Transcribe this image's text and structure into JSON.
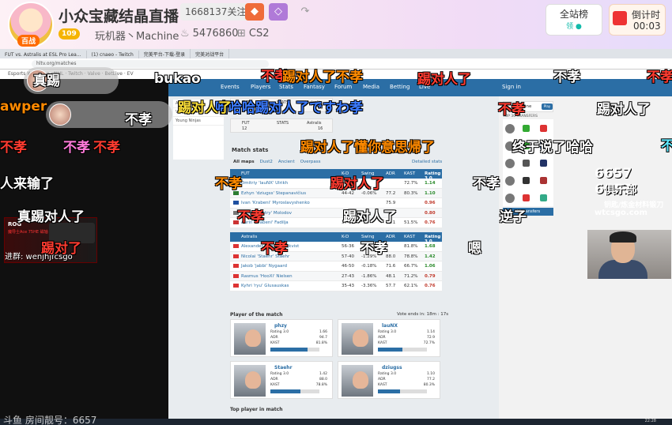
{
  "header": {
    "room_title": "小众宝藏结晶直播",
    "follow_count": "1668137关注",
    "level_badge": "109",
    "avatar_badge": "百战",
    "category": "玩机器丶Machine",
    "heat": "5476860",
    "game": "CS2",
    "rank_label": "全站榜",
    "rank_sub": "领 ●",
    "countdown_label": "倒计时",
    "countdown_time": "00:03"
  },
  "browser": {
    "tabs": [
      "FUT vs. Astralis at ESL Pro Lea...",
      "(1) cnaeo - Twitch",
      "完美平台-下载-登录",
      "完美对战平台"
    ],
    "address": "hltv.org/matches",
    "bookmarks": "Esports Wrestling · NHL · Twitch · Valve · BetLive · EV"
  },
  "site_nav": {
    "items": [
      "Events",
      "Players",
      "Stats",
      "Fantasy",
      "Forum",
      "Media",
      "Betting",
      "Live"
    ],
    "signin": "Sign in"
  },
  "page": {
    "left_col": [
      "Aurora",
      "Vitality",
      "Young Ninjas"
    ],
    "scores": [
      {
        "team_a": "FUT",
        "stat": "STATS",
        "team_b": "Astralis",
        "a": "12",
        "b": "16"
      },
      {
        "team_a": "FUT",
        "stat": "STATS",
        "team_b": "Astralis",
        "a": "12",
        "b": "16"
      }
    ],
    "match_stats_title": "Match stats",
    "filters": [
      "All maps",
      "Dust2",
      "Ancient",
      "Overpass"
    ],
    "detailed_stats": "Detailed stats",
    "fut_table": {
      "header": [
        "FUT",
        "K-D",
        "Swing",
        "ADR",
        "KAST",
        "Rating 3.0"
      ],
      "rows": [
        {
          "name": "Dmitriy 'lauNX' Ulrikh",
          "kd": "",
          "swing": "",
          "adr": "",
          "kast": "72.7%",
          "rating": "1.14"
        },
        {
          "name": "Ezhyn 'dziugss' Stepanavičius",
          "kd": "44-42",
          "swing": "-0.06%",
          "adr": "77.2",
          "kast": "80.3%",
          "rating": "1.10"
        },
        {
          "name": "Ivan 'Krabeni' Myroslavyshenko",
          "kd": "",
          "swing": "",
          "adr": "75.9",
          "kast": "",
          "rating": "0.96"
        },
        {
          "name": "Oleksii 'cmtry' Molodov",
          "kd": "",
          "swing": "",
          "adr": "",
          "kast": "",
          "rating": "0.80"
        },
        {
          "name": "Aurin 'Krabeni' Fadilja",
          "kd": "37-51",
          "swing": "",
          "adr": "62.1",
          "kast": "51.5%",
          "rating": "0.76"
        }
      ]
    },
    "ast_table": {
      "header": [
        "Astralis",
        "K-D",
        "Swing",
        "ADR",
        "KAST",
        "Rating 3.0"
      ],
      "rows": [
        {
          "name": "Alexander 'phzy' Bergkvist",
          "kd": "56-36",
          "swing": "",
          "adr": "",
          "kast": "81.8%",
          "rating": "1.68"
        },
        {
          "name": "Nicolai 'Staehr' Staehr",
          "kd": "57-40",
          "swing": "-1.29%",
          "adr": "88.0",
          "kast": "78.8%",
          "rating": "1.42"
        },
        {
          "name": "Jakob 'jabbi' Nygaard",
          "kd": "46-50",
          "swing": "-0.18%",
          "adr": "71.6",
          "kast": "66.7%",
          "rating": "1.06"
        },
        {
          "name": "Rasmus 'HooXi' Nielsen",
          "kd": "27-43",
          "swing": "-1.86%",
          "adr": "48.1",
          "kast": "71.2%",
          "rating": "0.79"
        },
        {
          "name": "Kyhri 'ryu' Glusauskas",
          "kd": "35-43",
          "swing": "-3.36%",
          "adr": "57.7",
          "kast": "62.1%",
          "rating": "0.76"
        }
      ]
    },
    "potm_title": "Player of the match",
    "vote_text": "Vote ends in: 18m : 17s",
    "potm": [
      {
        "name": "phzy",
        "rating": "1.66",
        "adr": "94.7",
        "kast": "81.8%",
        "bar": 0.75
      },
      {
        "name": "lauNX",
        "rating": "1.14",
        "adr": "72.9",
        "kast": "72.7%",
        "bar": 0.5
      },
      {
        "name": "Staehr",
        "rating": "1.42",
        "adr": "88.0",
        "kast": "78.8%",
        "bar": 0.62
      },
      {
        "name": "dziugss",
        "rating": "1.10",
        "adr": "77.2",
        "kast": "80.3%",
        "bar": 0.45
      }
    ],
    "potm_labels": {
      "rating": "Rating 3.0",
      "adr": "ADR",
      "kast": "KAST"
    },
    "top_player": "Top player in match"
  },
  "sidebar_right": {
    "timeline": "Timeline",
    "play": "Play",
    "transfers_title": "TOP 30 TRANSFERS",
    "all_transfers": "All transfers"
  },
  "ads": {
    "big": "6657 6657",
    "sub": "俱乐部",
    "line": "钥匙/炼金材料锻刀",
    "url": "wtcsgo.com",
    "rog_title": "ROG",
    "rog_sub": "魔导士Ace 75HE 磁轴",
    "rog_user": "进群: wenjhjfcsgo"
  },
  "danmaku": [
    {
      "text": "真踢",
      "cls": "",
      "pill": true
    },
    {
      "text": "bukao",
      "cls": ""
    },
    {
      "text": "不孝",
      "cls": "",
      "pill": true
    },
    {
      "text": "不孝",
      "cls": "red"
    },
    {
      "text": "踢对人了不孝",
      "cls": "orange"
    },
    {
      "text": "踢对人了",
      "cls": "red"
    },
    {
      "text": "不孝",
      "cls": ""
    },
    {
      "text": "不孝",
      "cls": "red"
    },
    {
      "text": "awper",
      "cls": "orange"
    },
    {
      "text": "哈哈哈踢对人了ですわ孝",
      "cls": "blue"
    },
    {
      "text": "不孝",
      "cls": "red"
    },
    {
      "text": "踢对人了",
      "cls": ""
    },
    {
      "text": "踢对人了",
      "cls": "yellow"
    },
    {
      "text": "不孝",
      "cls": "red"
    },
    {
      "text": "不孝",
      "cls": "cyan"
    },
    {
      "text": "不孝",
      "cls": "red"
    },
    {
      "text": "不孝",
      "cls": "pink"
    },
    {
      "text": "踢对人了懂你意思帰了",
      "cls": "orange"
    },
    {
      "text": "终于说了哈哈",
      "cls": ""
    },
    {
      "text": "人来输了",
      "cls": ""
    },
    {
      "text": "不孝",
      "cls": "orange"
    },
    {
      "text": "踢对人了",
      "cls": "red"
    },
    {
      "text": "不孝",
      "cls": ""
    },
    {
      "text": "真踢对人了",
      "cls": ""
    },
    {
      "text": "不孝",
      "cls": "red"
    },
    {
      "text": "踢对人了",
      "cls": ""
    },
    {
      "text": "逆子",
      "cls": ""
    },
    {
      "text": "踢对了",
      "cls": "red"
    },
    {
      "text": "不孝",
      "cls": "red"
    },
    {
      "text": "不孝",
      "cls": ""
    },
    {
      "text": "嗯",
      "cls": ""
    }
  ],
  "footer": {
    "room_no": "斗鱼 房间靓号：6657",
    "clock": "22:28"
  }
}
